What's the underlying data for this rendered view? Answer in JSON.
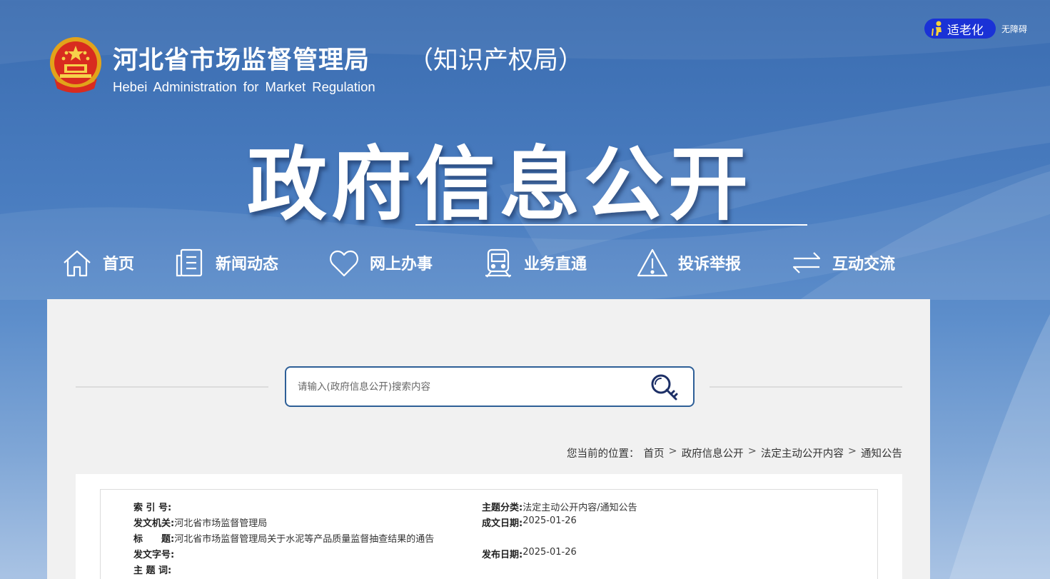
{
  "header": {
    "agency_cn": "河北省市场监督管理局",
    "agency_cn_suffix": "（知识产权局）",
    "agency_en": "Hebei Administration for Market Regulation",
    "elder_mode_label": "适老化",
    "accessibility_label": "无障碍",
    "banner_title": "政府信息公开"
  },
  "nav": {
    "items": [
      {
        "label": "首页",
        "icon": "home-icon"
      },
      {
        "label": "新闻动态",
        "icon": "news-icon"
      },
      {
        "label": "网上办事",
        "icon": "heart-icon"
      },
      {
        "label": "业务直通",
        "icon": "train-icon"
      },
      {
        "label": "投诉举报",
        "icon": "warning-icon"
      },
      {
        "label": "互动交流",
        "icon": "exchange-icon"
      }
    ]
  },
  "search": {
    "placeholder": "请输入(政府信息公开)搜索内容",
    "value": ""
  },
  "breadcrumb": {
    "prefix": "您当前的位置：",
    "items": [
      "首页",
      "政府信息公开",
      "法定主动公开内容",
      "通知公告"
    ],
    "separator": ">"
  },
  "document_meta": {
    "index_no": {
      "label": "索 引 号:",
      "value": ""
    },
    "category": {
      "label": "主题分类:",
      "value": "法定主动公开内容/通知公告"
    },
    "issuer": {
      "label": "发文机关:",
      "value": "河北省市场监督管理局"
    },
    "created_date": {
      "label": "成文日期:",
      "value": "2025-01-26"
    },
    "title": {
      "label": "标　　题:",
      "value": "河北省市场监督管理局关于水泥等产品质量监督抽查结果的通告"
    },
    "doc_number": {
      "label": "发文字号:",
      "value": ""
    },
    "published_date": {
      "label": "发布日期:",
      "value": "2025-01-26"
    },
    "keywords": {
      "label": "主 题 词:",
      "value": ""
    }
  },
  "colors": {
    "header_blue": "#3a6cb0",
    "elder_button": "#1a32d6",
    "search_border": "#2e5f97",
    "panel_bg": "#f1f1f1"
  }
}
